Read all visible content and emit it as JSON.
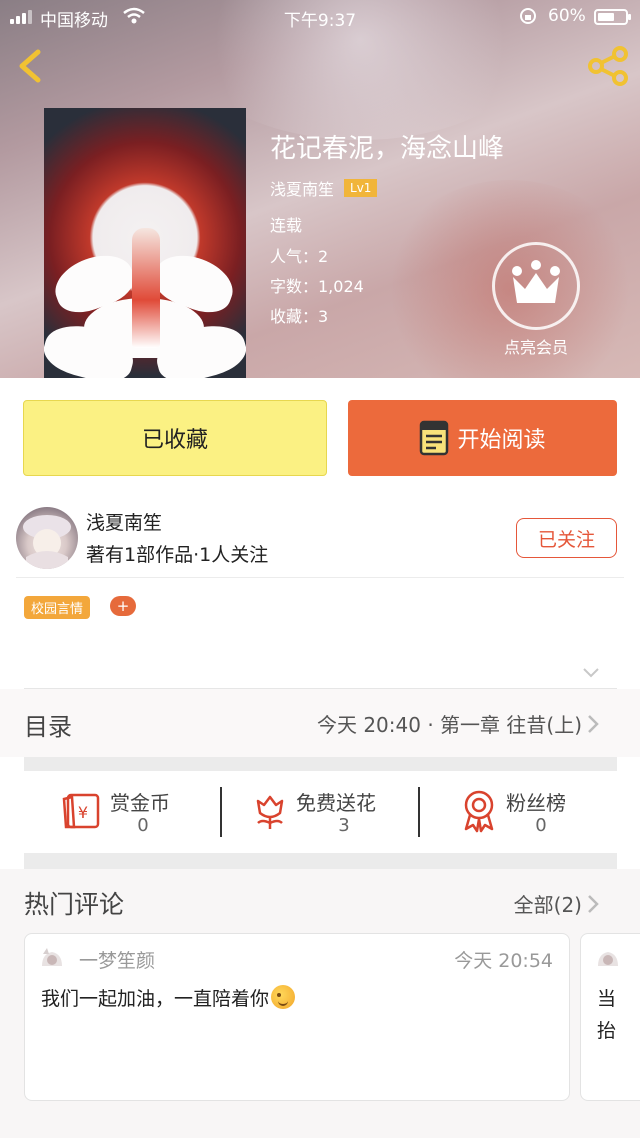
{
  "status_bar": {
    "carrier": "中国移动",
    "time": "下午9:37",
    "battery": "60%"
  },
  "book": {
    "title": "花记春泥，海念山峰",
    "author": "浅夏南笙",
    "level": "Lv1",
    "status": "连载",
    "popularity": "人气：2",
    "word_count": "字数：1,024",
    "favorites": "收藏：3"
  },
  "vip": {
    "label": "点亮会员"
  },
  "actions": {
    "favorite_label": "已收藏",
    "read_label": "开始阅读"
  },
  "author_info": {
    "name": "浅夏南笙",
    "stats": "著有1部作品·1人关注",
    "follow_label": "已关注"
  },
  "tags": {
    "items": [
      "校园言情"
    ],
    "add": "+"
  },
  "toc": {
    "label": "目录",
    "latest": "今天 20:40 · 第一章 往昔(上)"
  },
  "stats": {
    "coins_label": "赏金币",
    "coins_value": "0",
    "flowers_label": "免费送花",
    "flowers_value": "3",
    "fans_label": "粉丝榜",
    "fans_value": "0"
  },
  "comments": {
    "title": "热门评论",
    "all_label": "全部(2)",
    "items": [
      {
        "user": "一梦笙颜",
        "time": "今天 20:54",
        "text": "我们一起加油，一直陪着你"
      },
      {
        "text_line1": "当",
        "text_line2": "抬"
      }
    ]
  },
  "colors": {
    "accent_orange": "#ec6a3c",
    "favorite_yellow": "#fbf183",
    "level_badge": "#f1b53a",
    "tag_orange": "#f3a73b",
    "follow_red": "#e5573a"
  }
}
